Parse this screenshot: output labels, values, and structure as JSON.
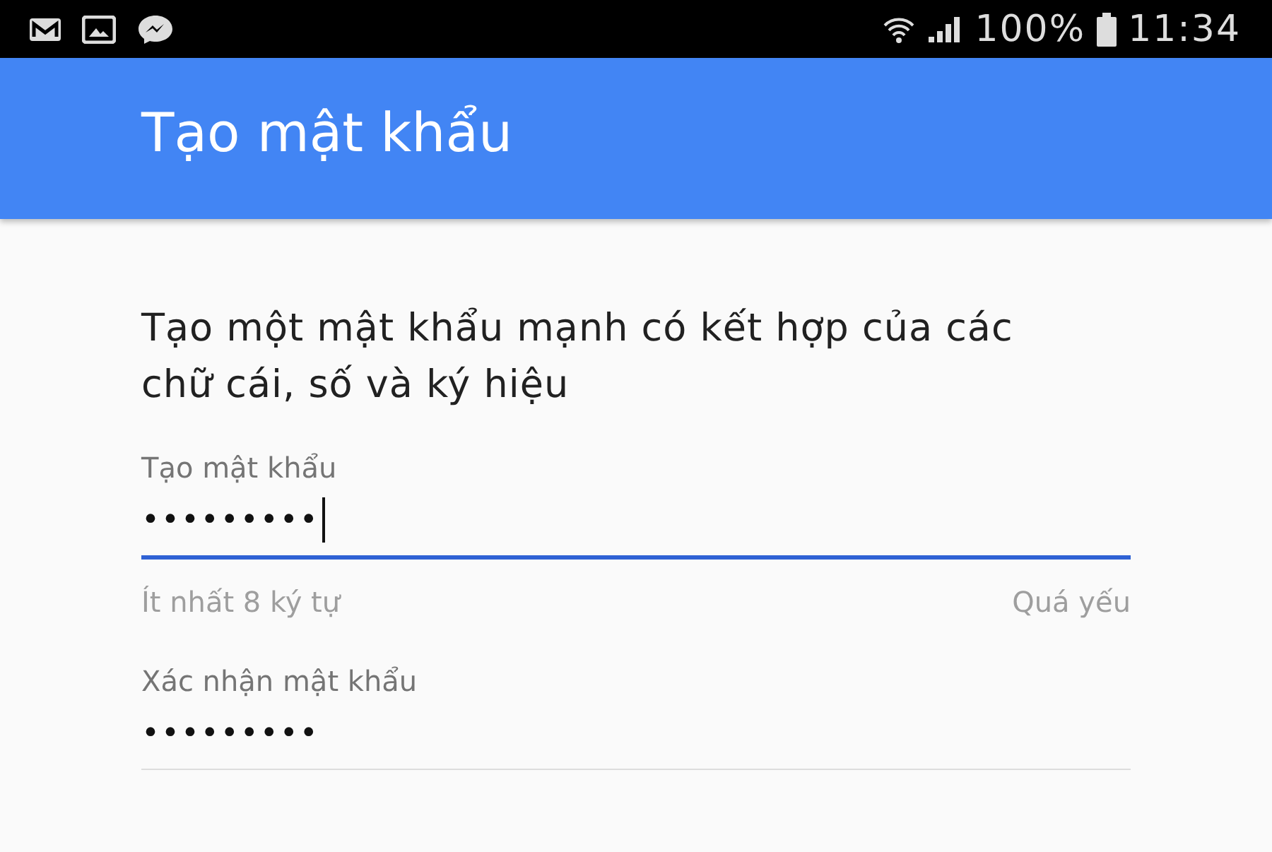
{
  "status_bar": {
    "battery": "100%",
    "time": "11:34"
  },
  "app_bar": {
    "title": "Tạo mật khẩu"
  },
  "instructions": "Tạo một mật khẩu mạnh có kết hợp của các chữ cái, số và ký hiệu",
  "fields": [
    {
      "label": "Tạo mật khẩu",
      "value": "•••••••••",
      "focused": true,
      "hint": "Ít nhất 8 ký tự",
      "strength": "Quá yếu"
    },
    {
      "label": "Xác nhận mật khẩu",
      "value": "•••••••••",
      "focused": false
    }
  ]
}
